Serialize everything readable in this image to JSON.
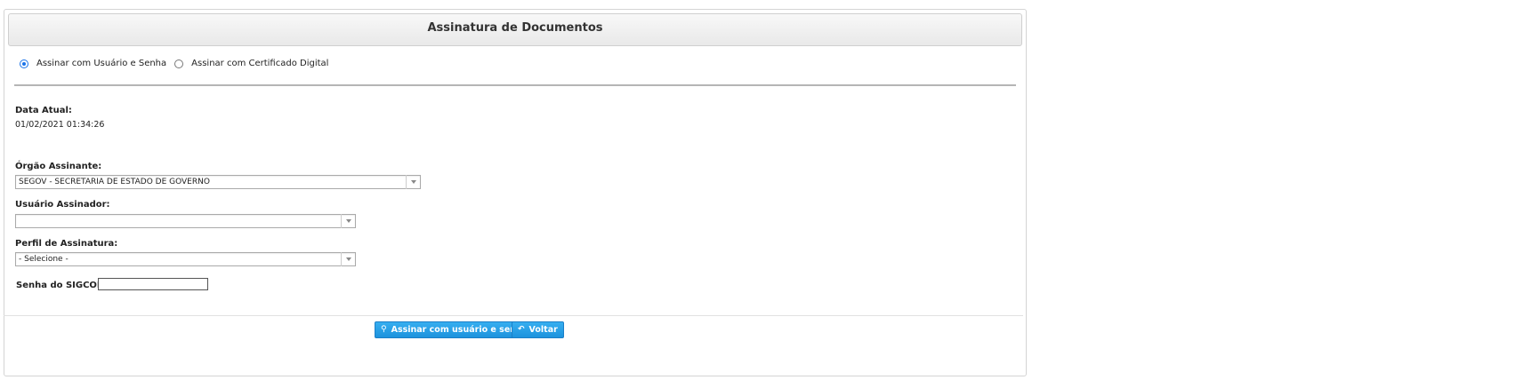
{
  "panel": {
    "title": "Assinatura de Documentos"
  },
  "sign_mode": {
    "options": [
      {
        "label": "Assinar com Usuário e Senha",
        "selected": true
      },
      {
        "label": "Assinar com Certificado Digital",
        "selected": false
      }
    ]
  },
  "date": {
    "label": "Data Atual:",
    "value": "01/02/2021 01:34:26"
  },
  "orgao": {
    "label": "Órgão Assinante:",
    "selected": "SEGOV - SECRETARIA DE ESTADO DE GOVERNO"
  },
  "usuario": {
    "label": "Usuário Assinador:",
    "selected": ""
  },
  "perfil": {
    "label": "Perfil de Assinatura:",
    "selected": "- Selecione -"
  },
  "senha": {
    "label": "Senha do SIGCON:",
    "value": ""
  },
  "buttons": {
    "sign_label": "Assinar com usuário e senha",
    "back_label": "Voltar",
    "sign_icon": "key-icon",
    "back_icon": "undo-arrow-icon"
  },
  "colors": {
    "accent": "#1d93dd",
    "radio": "#1a73e8"
  }
}
